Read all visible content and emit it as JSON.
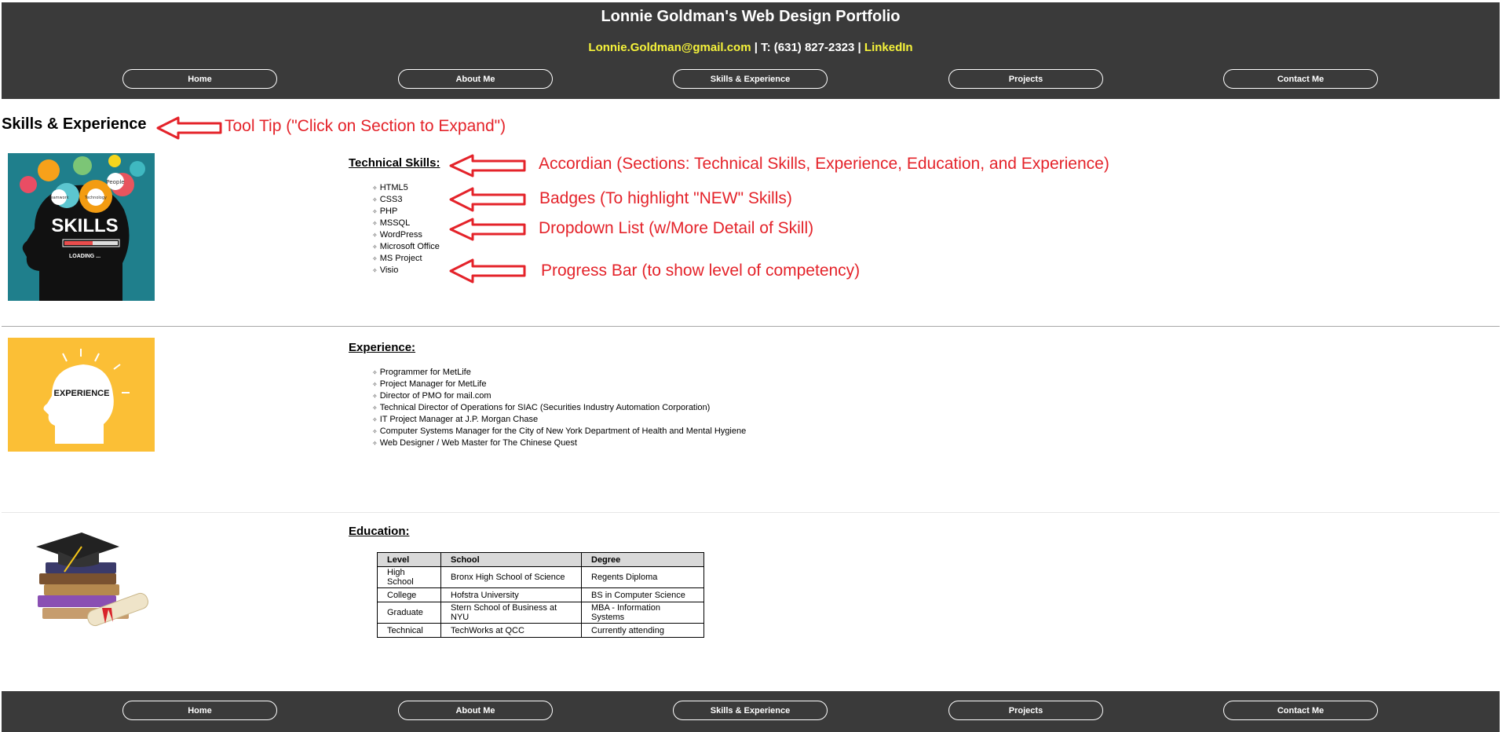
{
  "header": {
    "title": "Lonnie Goldman's Web Design Portfolio",
    "email": "Lonnie.Goldman@gmail.com",
    "separator": " | ",
    "phone": "T: (631) 827-2323",
    "linkedin": "LinkedIn"
  },
  "nav": [
    "Home",
    "About Me",
    "Skills & Experience",
    "Projects",
    "Contact Me"
  ],
  "page": {
    "title": "Skills & Experience"
  },
  "images": {
    "skills": {
      "main": "SKILLS",
      "sub": "LOADING ...",
      "gear1": "Teamwork",
      "gear2": "Technology",
      "gear3": "People"
    },
    "experience": {
      "label": "EXPERIENCE"
    }
  },
  "technical": {
    "heading": "Technical Skills:",
    "items": [
      "HTML5",
      "CSS3",
      "PHP",
      "MSSQL",
      "WordPress",
      "Microsoft Office",
      "MS Project",
      "Visio"
    ]
  },
  "experience": {
    "heading": "Experience:",
    "items": [
      "Programmer for MetLife",
      "Project Manager for MetLife",
      "Director of PMO for mail.com",
      "Technical Director of Operations for SIAC (Securities Industry Automation Corporation)",
      "IT Project Manager at J.P. Morgan Chase",
      "Computer Systems Manager for the City of New York Department of Health and Mental Hygiene",
      "Web Designer / Web Master for The Chinese Quest"
    ]
  },
  "education": {
    "heading": "Education:",
    "columns": [
      "Level",
      "School",
      "Degree"
    ],
    "rows": [
      [
        "High School",
        "Bronx High School of Science",
        "Regents Diploma"
      ],
      [
        "College",
        "Hofstra University",
        "BS in Computer Science"
      ],
      [
        "Graduate",
        "Stern School of Business at NYU",
        "MBA - Information Systems"
      ],
      [
        "Technical",
        "TechWorks at QCC",
        "Currently attending"
      ]
    ]
  },
  "annotations": {
    "tooltip": "Tool Tip (\"Click on Section to Expand\")",
    "accordion": "Accordian (Sections: Technical Skills, Experience, Education, and Experience)",
    "badges": "Badges (To highlight \"NEW\" Skills)",
    "dropdown": "Dropdown List (w/More Detail of Skill)",
    "progress": "Progress Bar (to show level of competency)"
  },
  "colors": {
    "bar": "#3a3a3a",
    "link_yellow": "#f6f33a",
    "annotation_red": "#e4232a",
    "skills_bg": "#1f7f8c",
    "experience_bg": "#fbbf36"
  }
}
